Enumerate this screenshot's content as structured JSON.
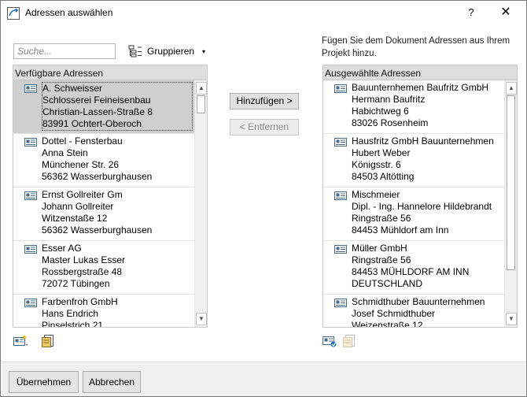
{
  "window": {
    "title": "Adressen auswählen",
    "help": "?",
    "close": "✕"
  },
  "toolbar": {
    "search_placeholder": "Suche...",
    "group_label": "Gruppieren",
    "group_caret": "▾"
  },
  "hint": "Fügen Sie dem Dokument Adressen aus Ihrem Projekt hinzu.",
  "available": {
    "header": "Verfügbare Adressen",
    "entries": [
      {
        "lines": [
          "A. Schweisser",
          "Schlosserei Feineisenbau",
          "Christian-Lassen-Straße 8",
          "83991 Ochtert-Oberoch"
        ],
        "selected": true
      },
      {
        "lines": [
          "Dottel - Fensterbau",
          "Anna Stein",
          "Münchener Str. 26",
          "56362 Wasserburghausen"
        ]
      },
      {
        "lines": [
          "Ernst Gollreiter Gm",
          "Johann Gollreiter",
          "Witzenstaße 12",
          "56362 Wasserburghausen"
        ]
      },
      {
        "lines": [
          "Esser AG",
          "Master Lukas Esser",
          "Rossbergstraße 48",
          "72072 Tübingen"
        ]
      },
      {
        "lines": [
          "Farbenfroh GmbH",
          "Hans Endrich",
          "Pinselstrich 21",
          ""
        ]
      }
    ]
  },
  "selected": {
    "header": "Ausgewählte Adressen",
    "entries": [
      {
        "lines": [
          "Bauunternhemen Baufritz GmbH",
          "Hermann Baufritz",
          "Habichtweg 6",
          "83026 Rosenheim"
        ]
      },
      {
        "lines": [
          "Hausfritz GmbH Bauunternehmen",
          "Hubert Weber",
          "Königsstr. 6",
          "84503 Altötting"
        ]
      },
      {
        "lines": [
          "Mischmeier",
          "Dipl. - Ing. Hannelore Hildebrandt",
          "Ringstraße 56",
          "84453 Mühldorf am Inn"
        ]
      },
      {
        "lines": [
          "Müller GmbH",
          "Ringstraße 56",
          "84453 MÜHLDORF AM INN",
          "DEUTSCHLAND"
        ]
      },
      {
        "lines": [
          "Schmidthuber Bauunternehmen",
          "Josef Schmidthuber",
          "Weizenstraße 12",
          ""
        ]
      }
    ]
  },
  "buttons": {
    "add": "Hinzufügen >",
    "remove": "< Entfernen",
    "apply": "Übernehmen",
    "cancel": "Abbrechen"
  },
  "colors": {
    "selection": "#cfcfcf",
    "header_bg": "#dedede",
    "footer_bg": "#f0f0f0",
    "accent_blue": "#1e6fb8"
  }
}
